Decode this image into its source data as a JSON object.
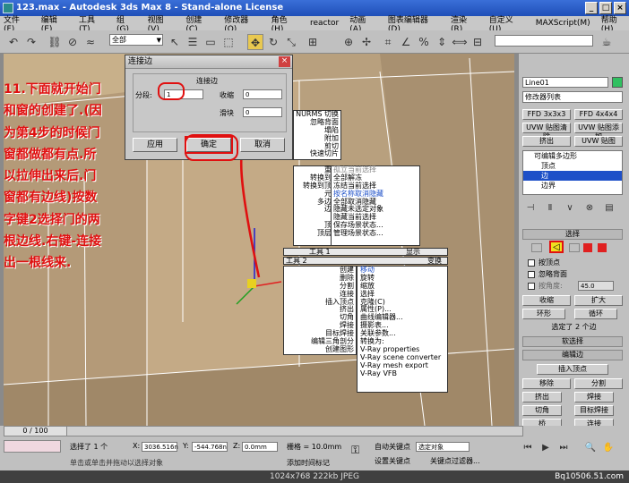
{
  "window": {
    "title": "123.max - Autodesk 3ds Max 8 - Stand-alone License",
    "controls": [
      "_",
      "□",
      "×"
    ]
  },
  "menubar": [
    "文件(F)",
    "编辑(E)",
    "工具(T)",
    "组(G)",
    "视图(V)",
    "创建(C)",
    "修改器(O)",
    "角色(H)",
    "reactor",
    "动画(A)",
    "图表编辑器(D)",
    "渲染(R)",
    "自定义(U)",
    "MAXScript(M)",
    "帮助(H)"
  ],
  "toolbar": {
    "selection_filter": "全部"
  },
  "dialog": {
    "title": "连接边",
    "group": "连接边",
    "segments_label": "分段:",
    "segments_value": "1",
    "pinch_label": "收缩",
    "pinch_value": "0",
    "slide_label": "滑块",
    "slide_value": "0",
    "apply": "应用",
    "ok": "确定",
    "cancel": "取消"
  },
  "annotation": [
    "11.下面就开始门",
    "和窗的创建了.(因",
    "为第4步的时候门",
    "窗都做都有点.所",
    "以拉伸出来后.门",
    "窗都有边线)按数",
    "字键2选择门的两",
    "根边线.右键-连接",
    "出一根线来."
  ],
  "quad_menu": {
    "top_left": [
      "NURMS 切换",
      "忽略背面",
      "塌陷",
      "附加",
      "剪切",
      "快速切片"
    ],
    "top_right": [
      "孤立当前选择",
      "全部解冻",
      "冻结当前选择",
      "按名称取消隐藏",
      "全部取消隐藏",
      "隐藏未选定对象",
      "隐藏当前选择",
      "保存场景状态...",
      "管理场景状态..."
    ],
    "mid_left": [
      "重复",
      "转换到面",
      "转换到顶点",
      "元素",
      "多边形",
      "边界",
      "边",
      "顶点",
      "顶层级"
    ],
    "header_tools1": "工具 1",
    "header_display": "显示",
    "header_tools2": "工具 2",
    "header_transform": "变换",
    "bottom_left": [
      "创建",
      "删除",
      "分割",
      "连接",
      "插入顶点",
      "挤出",
      "切角",
      "焊接",
      "目标焊接",
      "编辑三角剖分",
      "创建图形"
    ],
    "bottom_right": [
      "移动",
      "旋转",
      "缩放",
      "选择",
      "克隆(C)",
      "属性(P)...",
      "曲线编辑器...",
      "摄影表...",
      "关联参数...",
      "转换为:",
      "V-Ray properties",
      "V-Ray scene converter",
      "V-Ray mesh export",
      "V-Ray VFB"
    ]
  },
  "command_panel": {
    "object_name": "Line01",
    "modifier_list": "修改器列表",
    "buttons_row1": [
      "FFD 3x3x3",
      "FFD 4x4x4"
    ],
    "buttons_row2": [
      "UVW 贴图清除",
      "UVW 贴图添加"
    ],
    "buttons_row3": [
      "挤出",
      "UVW 贴图"
    ],
    "stack": [
      "可编辑多边形",
      "顶点",
      "边",
      "边界"
    ],
    "rollout_select": "选择",
    "by_vertex": "按顶点",
    "ignore_backface": "忽略背面",
    "by_angle": "按角度:",
    "angle_value": "45.0",
    "shrink": "收缩",
    "grow": "扩大",
    "ring": "环形",
    "loop": "循环",
    "selected_count": "选定了 2 个边",
    "soft_selection": "软选择",
    "edit_edges": "编辑边",
    "insert_vertex": "插入顶点",
    "remove": "移除",
    "split": "分割",
    "extrude": "挤出",
    "weld": "焊接",
    "chamfer": "切角",
    "target_weld": "目标焊接",
    "bridge": "桥",
    "connect": "连接"
  },
  "statusbar": {
    "timeline": "0 / 100",
    "selected": "选择了 1 个",
    "x": "3036.516n",
    "y": "-544.768n",
    "z": "0.0mm",
    "grid": "栅格 = 10.0mm",
    "auto_key": "自动关键点",
    "selected_object": "选定对象",
    "set_key": "设置关键点",
    "key_filters": "关键点过滤器...",
    "prompt": "单击或单击并拖动以选择对象",
    "add_time_tag": "添加时间标记"
  },
  "caption": {
    "info": "1024x768  222kb  JPEG",
    "watermark": "Bq10506.51.com"
  },
  "colors": {
    "title_blue": "#2a5fd0",
    "annotation_red": "#e01010",
    "selected_blue": "#1e50c8"
  }
}
